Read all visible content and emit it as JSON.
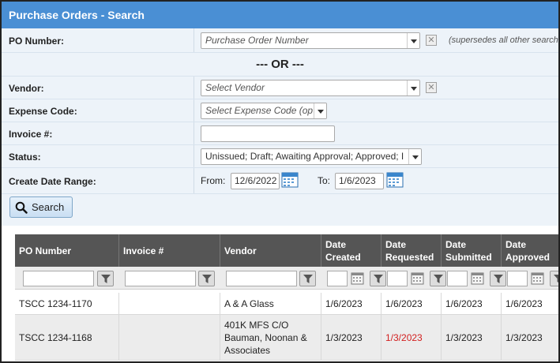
{
  "window": {
    "title": "Purchase Orders - Search"
  },
  "form": {
    "po_number": {
      "label": "PO Number:",
      "placeholder": "Purchase Order Number",
      "hint": "(supersedes all other search"
    },
    "or_text": "--- OR ---",
    "vendor": {
      "label": "Vendor:",
      "placeholder": "Select Vendor"
    },
    "expense_code": {
      "label": "Expense Code:",
      "placeholder": "Select Expense Code (op"
    },
    "invoice": {
      "label": "Invoice #:",
      "value": ""
    },
    "status": {
      "label": "Status:",
      "value": "Unissued; Draft; Awaiting Approval; Approved; I"
    },
    "date_range": {
      "label": "Create Date Range:",
      "from_label": "From:",
      "from_value": "12/6/2022",
      "to_label": "To:",
      "to_value": "1/6/2023"
    },
    "search_label": "Search"
  },
  "grid": {
    "columns": [
      {
        "line1": "PO Number",
        "line2": ""
      },
      {
        "line1": "Invoice #",
        "line2": ""
      },
      {
        "line1": "Vendor",
        "line2": ""
      },
      {
        "line1": "Date",
        "line2": "Created"
      },
      {
        "line1": "Date",
        "line2": "Requested"
      },
      {
        "line1": "Date",
        "line2": "Submitted"
      },
      {
        "line1": "Date",
        "line2": "Approved"
      }
    ],
    "rows": [
      {
        "po": "TSCC 1234-1170",
        "invoice": "",
        "vendor": [
          "A & A Glass"
        ],
        "created": "1/6/2023",
        "requested": "1/6/2023",
        "submitted": "1/6/2023",
        "approved": "1/6/2023",
        "requested_overdue": false
      },
      {
        "po": "TSCC 1234-1168",
        "invoice": "",
        "vendor": [
          "401K MFS C/O",
          "Bauman, Noonan &",
          "Associates"
        ],
        "created": "1/3/2023",
        "requested": "1/3/2023",
        "submitted": "1/3/2023",
        "approved": "1/3/2023",
        "requested_overdue": true
      }
    ]
  },
  "colors": {
    "titlebar": "#4a8fd4",
    "form_bg": "#edf3f9",
    "grid_header": "#555555",
    "overdue": "#d21f1f"
  }
}
